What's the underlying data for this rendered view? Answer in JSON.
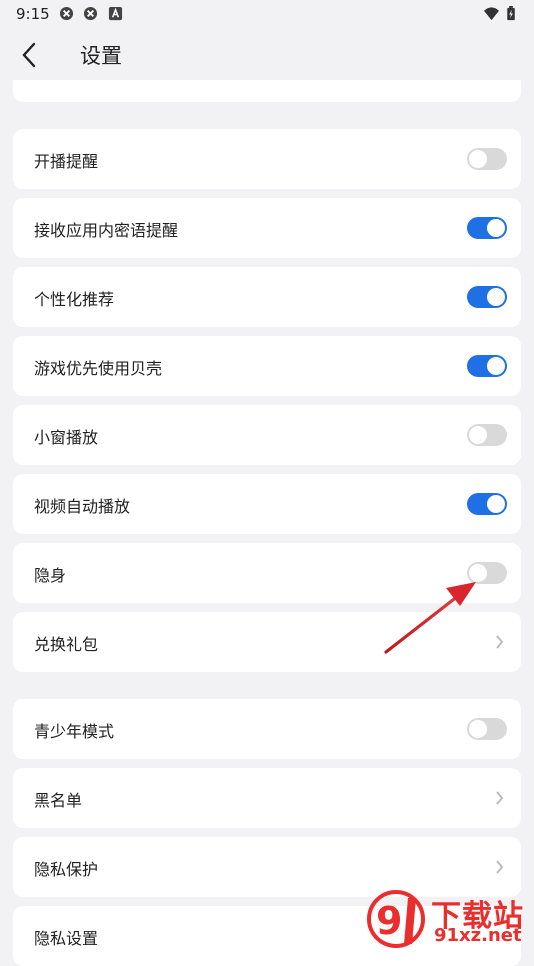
{
  "status_bar": {
    "time": "9:15"
  },
  "header": {
    "title": "设置"
  },
  "partial_top_label": "...",
  "settings": [
    {
      "label": "开播提醒",
      "control": "toggle",
      "on": false
    },
    {
      "label": "接收应用内密语提醒",
      "control": "toggle",
      "on": true
    },
    {
      "label": "个性化推荐",
      "control": "toggle",
      "on": true
    },
    {
      "label": "游戏优先使用贝壳",
      "control": "toggle",
      "on": true
    },
    {
      "label": "小窗播放",
      "control": "toggle",
      "on": false
    },
    {
      "label": "视频自动播放",
      "control": "toggle",
      "on": true
    },
    {
      "label": "隐身",
      "control": "toggle",
      "on": false
    },
    {
      "label": "兑换礼包",
      "control": "chevron"
    },
    {
      "label": "青少年模式",
      "control": "toggle",
      "on": false
    },
    {
      "label": "黑名单",
      "control": "chevron"
    },
    {
      "label": "隐私保护",
      "control": "chevron"
    },
    {
      "label": "隐私设置",
      "control": "none"
    }
  ],
  "watermark": {
    "line1": "下载站",
    "line2": "91xz.net"
  },
  "colors": {
    "toggle_on": "#1f6fe5",
    "toggle_off": "#d9d9d9",
    "background": "#f2f2f4",
    "annotation": "#d9262c"
  }
}
